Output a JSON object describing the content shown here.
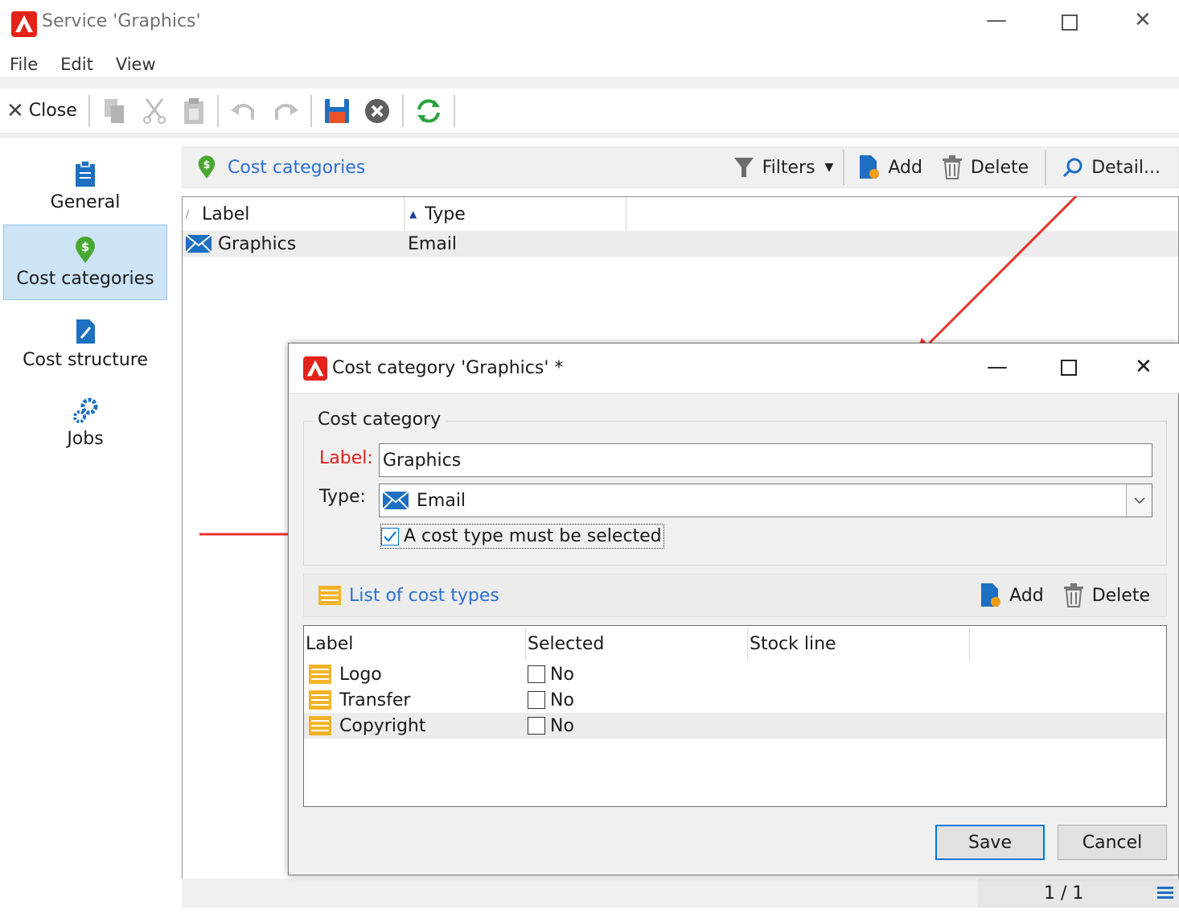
{
  "window": {
    "title": "Service 'Graphics'"
  },
  "menu": [
    "File",
    "Edit",
    "View"
  ],
  "toolbar": {
    "close_label": "Close"
  },
  "nav": [
    {
      "label": "General",
      "icon": "clipboard-icon"
    },
    {
      "label": "Cost categories",
      "icon": "dollar-pin-icon"
    },
    {
      "label": "Cost structure",
      "icon": "edit-doc-icon"
    },
    {
      "label": "Jobs",
      "icon": "gears-icon"
    }
  ],
  "pane": {
    "title": "Cost categories",
    "filters_label": "Filters",
    "add_label": "Add",
    "delete_label": "Delete",
    "detail_label": "Detail...",
    "columns": {
      "label": "Label",
      "type": "Type"
    },
    "rows": [
      {
        "label": "Graphics",
        "type": "Email"
      }
    ],
    "pager": "1 / 1"
  },
  "dialog": {
    "title": "Cost category 'Graphics' *",
    "group_title": "Cost category",
    "label_caption": "Label:",
    "label_value": "Graphics",
    "type_caption": "Type:",
    "type_value": "Email",
    "checkbox_label": "A cost type must be selected",
    "checkbox_checked": true,
    "list_title": "List of cost types",
    "add_label": "Add",
    "delete_label": "Delete",
    "columns": {
      "label": "Label",
      "selected": "Selected",
      "stock_line": "Stock line"
    },
    "rows": [
      {
        "label": "Logo",
        "selected": "No"
      },
      {
        "label": "Transfer",
        "selected": "No"
      },
      {
        "label": "Copyright",
        "selected": "No"
      }
    ],
    "save_label": "Save",
    "cancel_label": "Cancel"
  },
  "colors": {
    "accent": "#0078d7",
    "link": "#2c6fd1",
    "required": "#e21e1e",
    "annotation_arrow": "#e8332a",
    "nav_selected": "#cde4f7"
  }
}
